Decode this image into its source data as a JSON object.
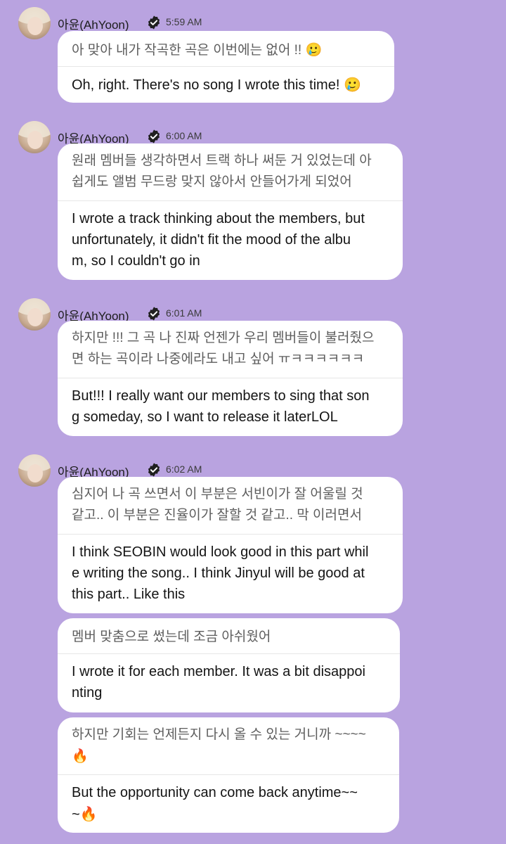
{
  "messages": [
    {
      "author": "아윤(AhYoon)",
      "time": "5:59 AM",
      "bubbles": [
        {
          "ko": [
            "아 맞아 내가 작곡한 곡은 이번에는 없어 !! 🥲"
          ],
          "en": [
            "Oh, right. There's no song I wrote this time! 🥲"
          ]
        }
      ]
    },
    {
      "author": "아윤(AhYoon)",
      "time": "6:00 AM",
      "bubbles": [
        {
          "ko": [
            "원래 멤버들 생각하면서 트랙 하나 써둔 거 있었는데 아",
            "쉽게도 앨범 무드랑 맞지 않아서 안들어가게 되었어"
          ],
          "en": [
            "I wrote a track thinking about the members, but",
            " unfortunately, it didn't fit the mood of the albu",
            "m, so I couldn't go in"
          ]
        }
      ]
    },
    {
      "author": "아윤(AhYoon)",
      "time": "6:01 AM",
      "bubbles": [
        {
          "ko": [
            "하지만 !!! 그 곡 나 진짜 언젠가 우리 멤버들이 불러줬으",
            "면 하는 곡이라 나중에라도 내고 싶어 ㅠㅋㅋㅋㅋㅋㅋ"
          ],
          "en": [
            "But!!! I really want our members to sing that son",
            "g someday, so I want to release it laterLOL"
          ]
        }
      ]
    },
    {
      "author": "아윤(AhYoon)",
      "time": "6:02 AM",
      "bubbles": [
        {
          "ko": [
            "심지어 나 곡 쓰면서 이 부분은 서빈이가 잘 어울릴 것",
            "같고.. 이 부분은 진율이가 잘할 것 같고.. 막 이러면서"
          ],
          "en": [
            "I think SEOBIN would look good in this part whil",
            "e writing the song.. I think Jinyul will be good at",
            " this part.. Like this"
          ]
        },
        {
          "ko": [
            "멤버 맞춤으로 썼는데 조금 아쉬웠어"
          ],
          "en": [
            "I wrote it for each member. It was a bit disappoi",
            "nting"
          ]
        },
        {
          "ko": [
            "하지만 기회는 언제든지 다시 올 수 있는 거니까 ~~~~",
            "🔥"
          ],
          "en": [
            "But the opportunity can come back anytime~~",
            "~🔥"
          ]
        }
      ]
    }
  ],
  "colors": {
    "background": "#b9a3e0",
    "bubble": "#ffffff",
    "korean_text": "#5d5d5d",
    "english_text": "#141414",
    "verified_badge": "#1f1f1f"
  },
  "icons": {
    "verified": "verified-badge-icon",
    "avatar": "avatar"
  }
}
